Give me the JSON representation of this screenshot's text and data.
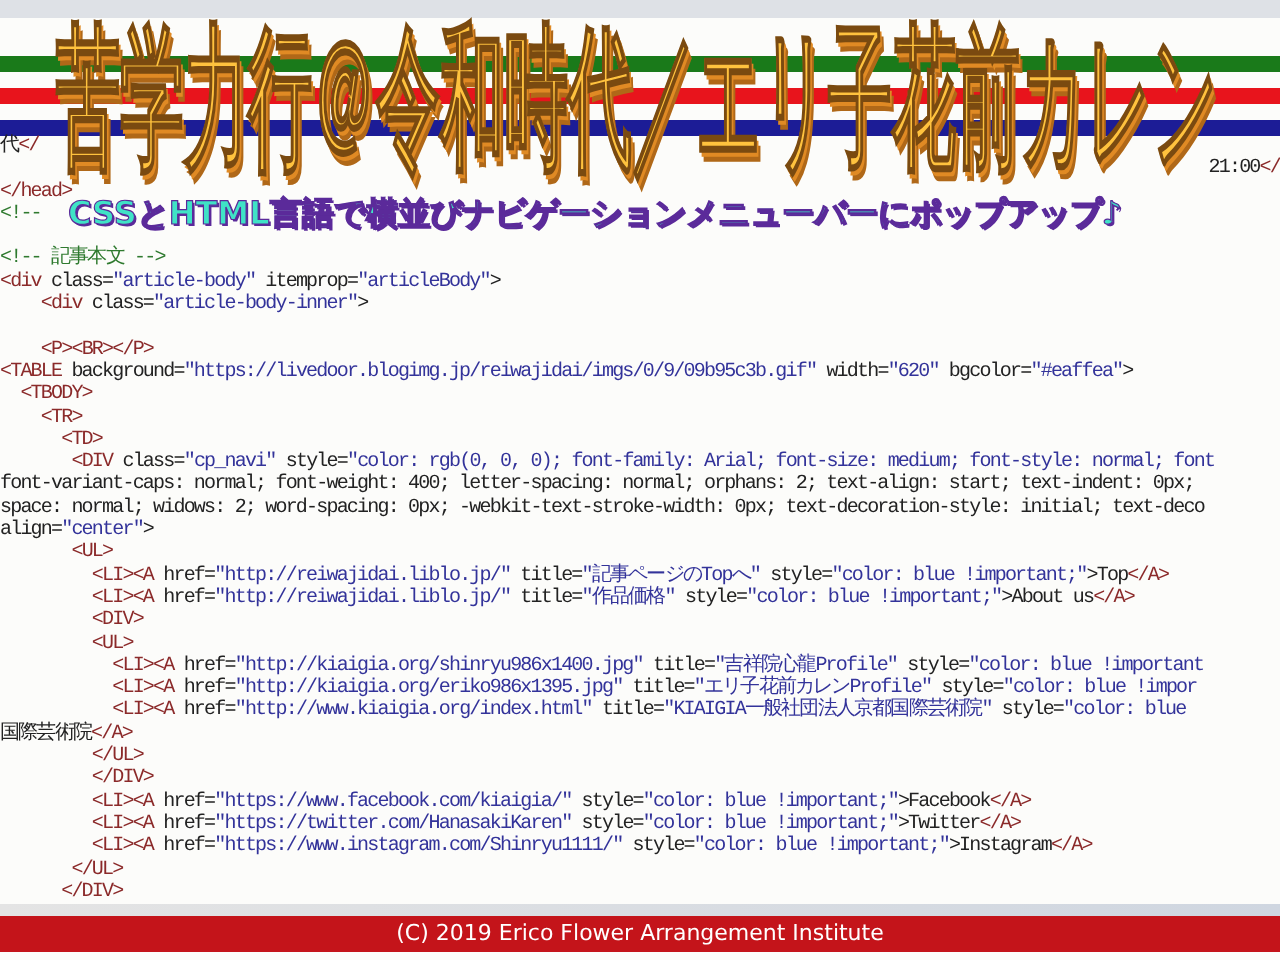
{
  "title": "苦学力行＠令和時代／エリ子花前カレン",
  "subtitle": "CSSとHTML言語で横並びナビゲーションメニューバーにポップアップ♪",
  "stripes": [
    {
      "color": "#1a7a1a"
    },
    {
      "color": "#e8141c"
    },
    {
      "color": "#1c1c96"
    }
  ],
  "source_lines": [
    {
      "kind": "code",
      "text": "代</"
    },
    {
      "kind": "tail",
      "text": "21:00</"
    },
    {
      "kind": "code",
      "text": "</head>"
    },
    {
      "kind": "comment",
      "text": "<!--"
    },
    {
      "kind": "blank"
    },
    {
      "kind": "comment",
      "text": "<!-- 記事本文 -->"
    },
    {
      "kind": "code",
      "text": "<div class=\"article-body\" itemprop=\"articleBody\">"
    },
    {
      "kind": "code",
      "text": "    <div class=\"article-body-inner\">"
    },
    {
      "kind": "blank"
    },
    {
      "kind": "code",
      "text": "    <P><BR></P>"
    },
    {
      "kind": "code",
      "text": "<TABLE background=\"https://livedoor.blogimg.jp/reiwajidai/imgs/0/9/09b95c3b.gif\" width=\"620\" bgcolor=\"#eaffea\">"
    },
    {
      "kind": "code",
      "text": "  <TBODY>"
    },
    {
      "kind": "code",
      "text": "    <TR>"
    },
    {
      "kind": "code",
      "text": "      <TD>"
    },
    {
      "kind": "code",
      "text": "       <DIV class=\"cp_navi\" style=\"color: rgb(0, 0, 0); font-family: Arial; font-size: medium; font-style: normal; font"
    },
    {
      "kind": "code",
      "text": "font-variant-caps: normal; font-weight: 400; letter-spacing: normal; orphans: 2; text-align: start; text-indent: 0px;"
    },
    {
      "kind": "code",
      "text": "space: normal; widows: 2; word-spacing: 0px; -webkit-text-stroke-width: 0px; text-decoration-style: initial; text-deco"
    },
    {
      "kind": "code",
      "text": "align=\"center\">"
    },
    {
      "kind": "code",
      "text": "       <UL>"
    },
    {
      "kind": "code",
      "text": "         <LI><A href=\"http://reiwajidai.liblo.jp/\" title=\"記事ページのTopへ\" style=\"color: blue !important;\">Top</A>"
    },
    {
      "kind": "code",
      "text": "         <LI><A href=\"http://reiwajidai.liblo.jp/\" title=\"作品価格\" style=\"color: blue !important;\">About us</A>"
    },
    {
      "kind": "code",
      "text": "         <DIV>"
    },
    {
      "kind": "code",
      "text": "         <UL>"
    },
    {
      "kind": "code",
      "text": "           <LI><A href=\"http://kiaigia.org/shinryu986x1400.jpg\" title=\"吉祥院心龍Profile\" style=\"color: blue !important"
    },
    {
      "kind": "code",
      "text": "           <LI><A href=\"http://kiaigia.org/eriko986x1395.jpg\" title=\"エリ子花前カレンProfile\" style=\"color: blue !impor"
    },
    {
      "kind": "code",
      "text": "           <LI><A href=\"http://www.kiaigia.org/index.html\" title=\"KIAIGIA一般社団法人京都国際芸術院\" style=\"color: blue"
    },
    {
      "kind": "code",
      "text": "国際芸術院</A>"
    },
    {
      "kind": "code",
      "text": "         </UL>"
    },
    {
      "kind": "code",
      "text": "         </DIV>"
    },
    {
      "kind": "code",
      "text": "         <LI><A href=\"https://www.facebook.com/kiaigia/\" style=\"color: blue !important;\">Facebook</A>"
    },
    {
      "kind": "code",
      "text": "         <LI><A href=\"https://twitter.com/HanasakiKaren\" style=\"color: blue !important;\">Twitter</A>"
    },
    {
      "kind": "code",
      "text": "         <LI><A href=\"https://www.instagram.com/Shinryu1111/\" style=\"color: blue !important;\">Instagram</A>"
    },
    {
      "kind": "code",
      "text": "       </UL>"
    },
    {
      "kind": "code",
      "text": "      </DIV>"
    }
  ],
  "footer": "(C) 2019 Erico Flower Arrangement Institute"
}
